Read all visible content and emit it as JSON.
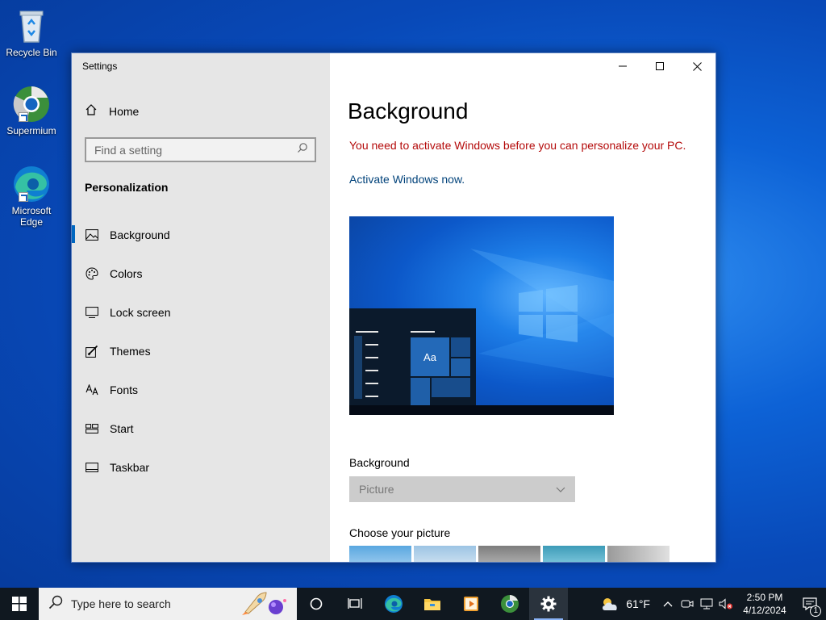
{
  "desktop": {
    "icons": [
      {
        "label": "Recycle Bin"
      },
      {
        "label": "Supermium"
      },
      {
        "label": "Microsoft Edge"
      }
    ]
  },
  "window": {
    "title": "Settings",
    "nav": {
      "home": "Home",
      "search_placeholder": "Find a setting",
      "section": "Personalization",
      "items": [
        {
          "label": "Background",
          "icon": "picture-icon"
        },
        {
          "label": "Colors",
          "icon": "palette-icon"
        },
        {
          "label": "Lock screen",
          "icon": "monitor-icon"
        },
        {
          "label": "Themes",
          "icon": "brush-icon"
        },
        {
          "label": "Fonts",
          "icon": "font-icon"
        },
        {
          "label": "Start",
          "icon": "grid-icon"
        },
        {
          "label": "Taskbar",
          "icon": "taskbar-icon"
        }
      ]
    },
    "content": {
      "title": "Background",
      "warning": "You need to activate Windows before you can personalize your PC.",
      "activate_link": "Activate Windows now.",
      "preview_tile": "Aa",
      "background_label": "Background",
      "background_value": "Picture",
      "choose_label": "Choose your picture"
    }
  },
  "taskbar": {
    "search_placeholder": "Type here to search",
    "weather": "61°F",
    "time": "2:50 PM",
    "date": "4/12/2024",
    "notifications": "1"
  },
  "colors": {
    "accent": "#0067c0",
    "warning": "#b40a0a",
    "link": "#00427a"
  }
}
